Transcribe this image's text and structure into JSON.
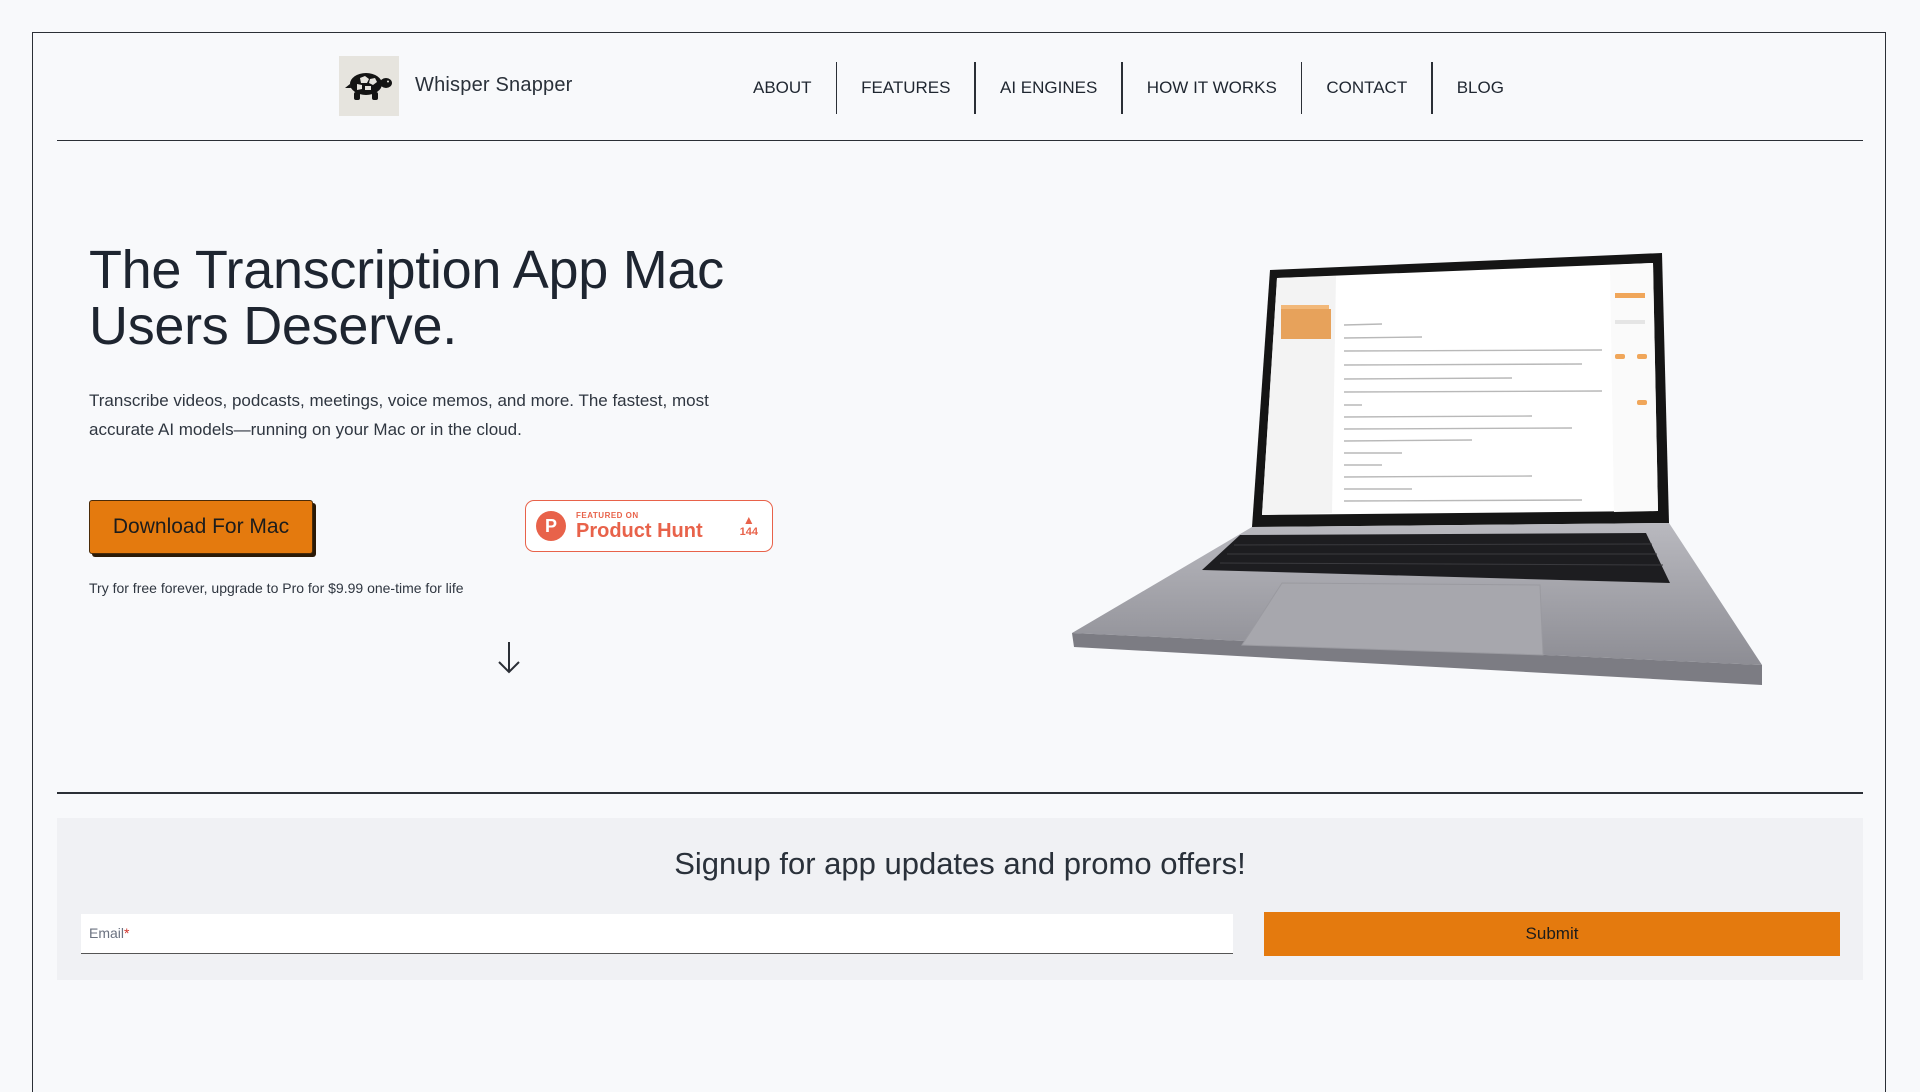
{
  "brand": {
    "name": "Whisper Snapper",
    "logo_icon": "turtle-icon"
  },
  "nav": {
    "items": [
      {
        "label": "ABOUT"
      },
      {
        "label": "FEATURES"
      },
      {
        "label": "AI ENGINES"
      },
      {
        "label": "HOW IT WORKS"
      },
      {
        "label": "CONTACT"
      },
      {
        "label": "BLOG"
      }
    ]
  },
  "hero": {
    "title_line1": "The Transcription App Mac",
    "title_line2": "Users Deserve.",
    "subtitle_line1": "Transcribe videos, podcasts, meetings, voice memos, and more. The fastest, most",
    "subtitle_line2": "accurate AI models—running on your Mac or in the cloud.",
    "download_label": "Download For Mac",
    "free_note": "Try for free forever, upgrade to Pro for $9.99 one-time for life"
  },
  "product_hunt": {
    "featured": "FEATURED ON",
    "name": "Product Hunt",
    "votes": "144",
    "logo_letter": "P"
  },
  "signup": {
    "title": "Signup for app updates and promo offers!",
    "email_label": "Email",
    "required_mark": "*",
    "submit_label": "Submit"
  },
  "colors": {
    "accent": "#e47a0e",
    "product_hunt": "#e8624a",
    "text": "#1f2630",
    "background": "#f8f9fb"
  }
}
